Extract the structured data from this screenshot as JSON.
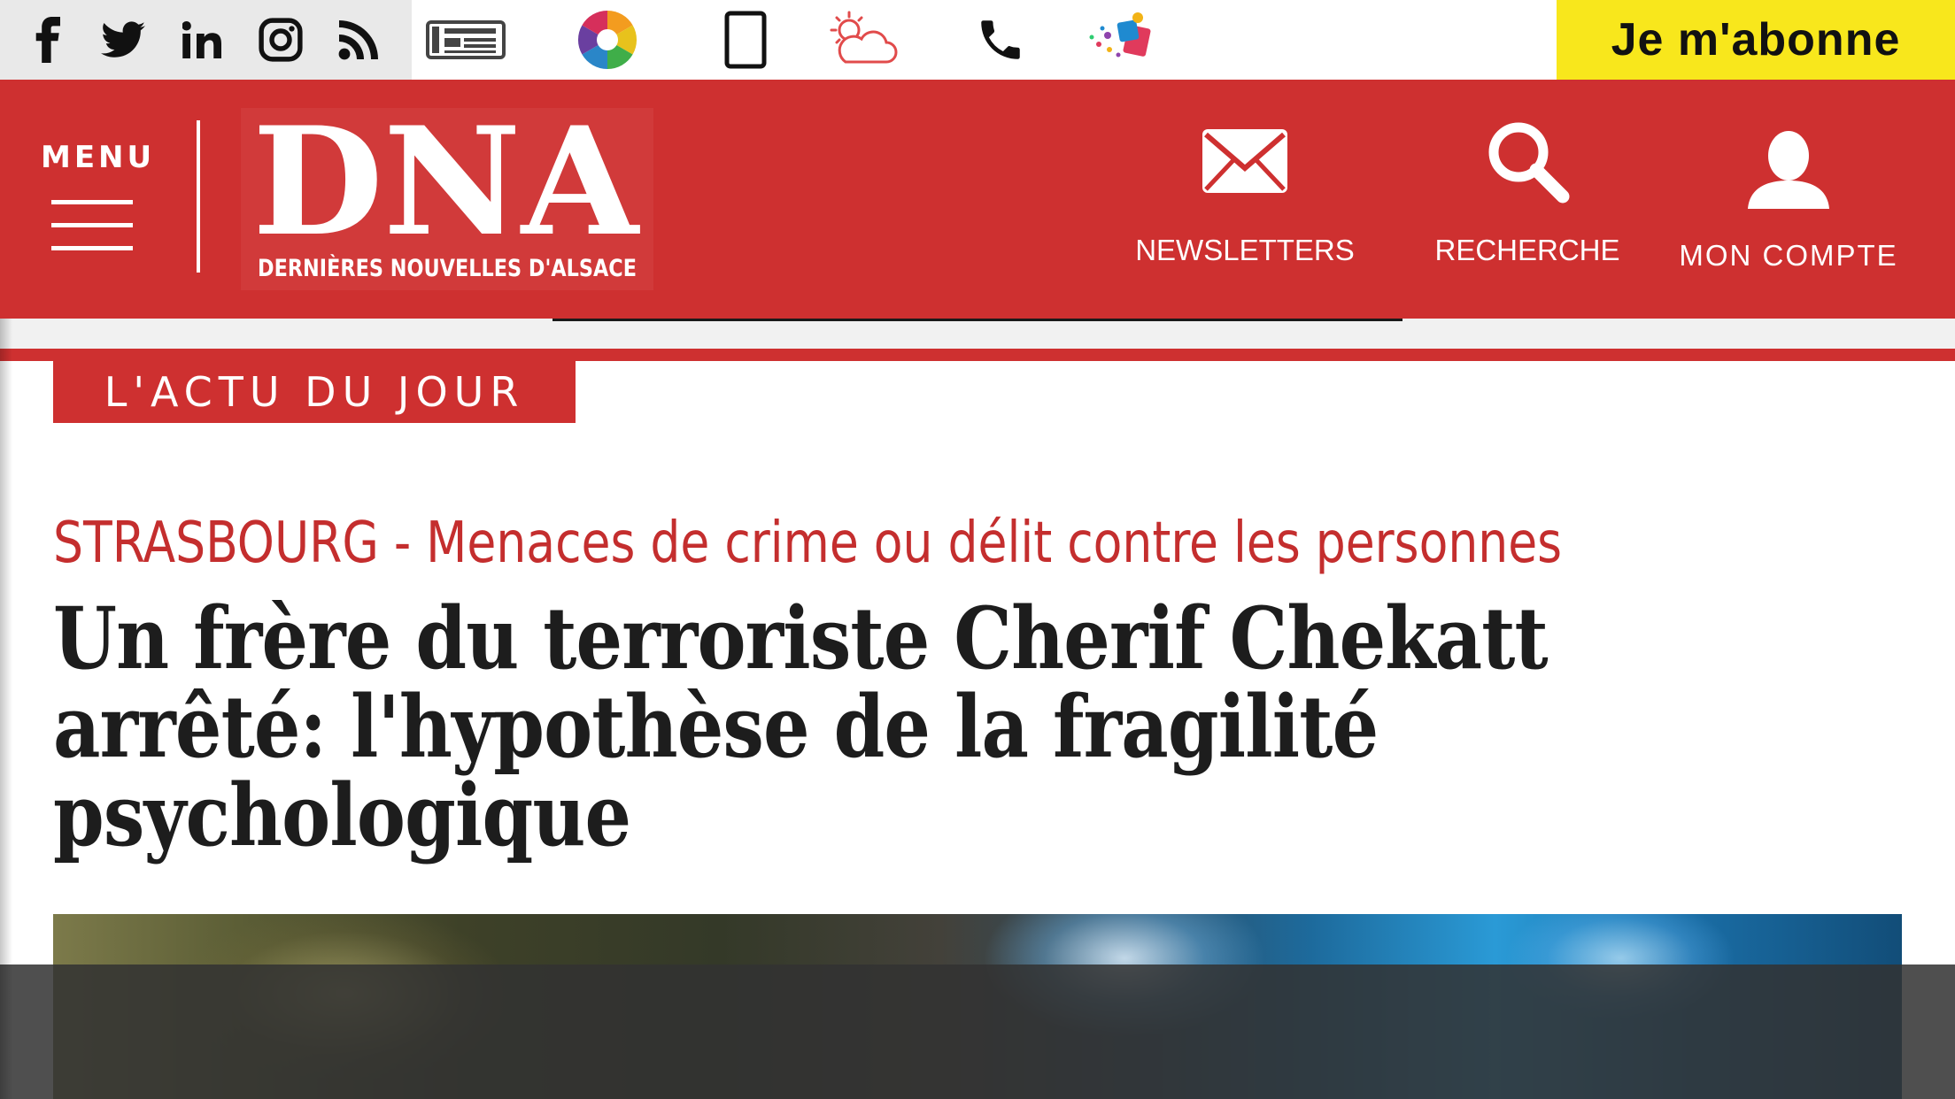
{
  "top_bar": {
    "social_icons": [
      "facebook-icon",
      "twitter-icon",
      "linkedin-icon",
      "instagram-icon",
      "rss-icon"
    ],
    "service_icons": [
      "epaper-icon",
      "photo-aperture-icon",
      "mobile-phone-icon",
      "weather-icon",
      "phone-icon",
      "games-icon"
    ],
    "subscribe_label": "Je m'abonne"
  },
  "header": {
    "menu_label": "MENU",
    "logo": {
      "wordmark": "DNA",
      "tagline": "DERNIÈRES NOUVELLES D'ALSACE"
    },
    "newsletters_label": "NEWSLETTERS",
    "search_label": "RECHERCHE",
    "account_label": "MON COMPTE"
  },
  "section_tag": "L'ACTU DU JOUR",
  "article": {
    "kicker": "STRASBOURG - Menaces de crime ou délit contre les personnes",
    "headline": "Un frère du terroriste Cherif Chekatt arrêté: l'hypothèse de la fragilité psychologique"
  },
  "colors": {
    "brand_red": "#ce3030",
    "subscribe_yellow": "#f8e71c",
    "kicker_red": "#c42e2e",
    "headline": "#1d1d1d"
  }
}
